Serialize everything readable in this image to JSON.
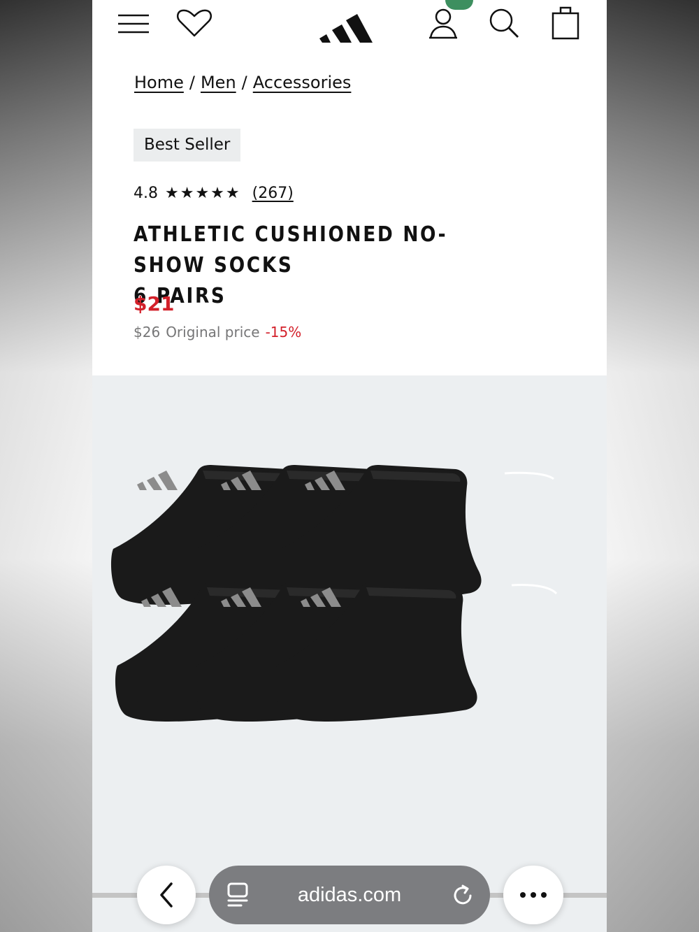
{
  "breadcrumb": {
    "items": [
      "Home",
      "Men",
      "Accessories"
    ],
    "separator": "/"
  },
  "badge": "Best Seller",
  "rating": {
    "value": "4.8",
    "stars": "★★★★★",
    "reviews": "(267)"
  },
  "product": {
    "title_line1": "ATHLETIC CUSHIONED NO-SHOW SOCKS",
    "title_line2": "6 PAIRS",
    "sale_price": "$21",
    "original_price": "$26",
    "original_label": "Original price",
    "discount": "-15%"
  },
  "browser": {
    "url": "adidas.com"
  },
  "colors": {
    "sale": "#d3202a",
    "badge_bg": "#ebedee",
    "notification": "#3d8f5f"
  },
  "icons": [
    "menu-icon",
    "heart-icon",
    "adidas-logo",
    "account-icon",
    "search-icon",
    "shopping-bag-icon",
    "chevron-left-icon",
    "tabs-icon",
    "reload-icon",
    "more-icon"
  ]
}
